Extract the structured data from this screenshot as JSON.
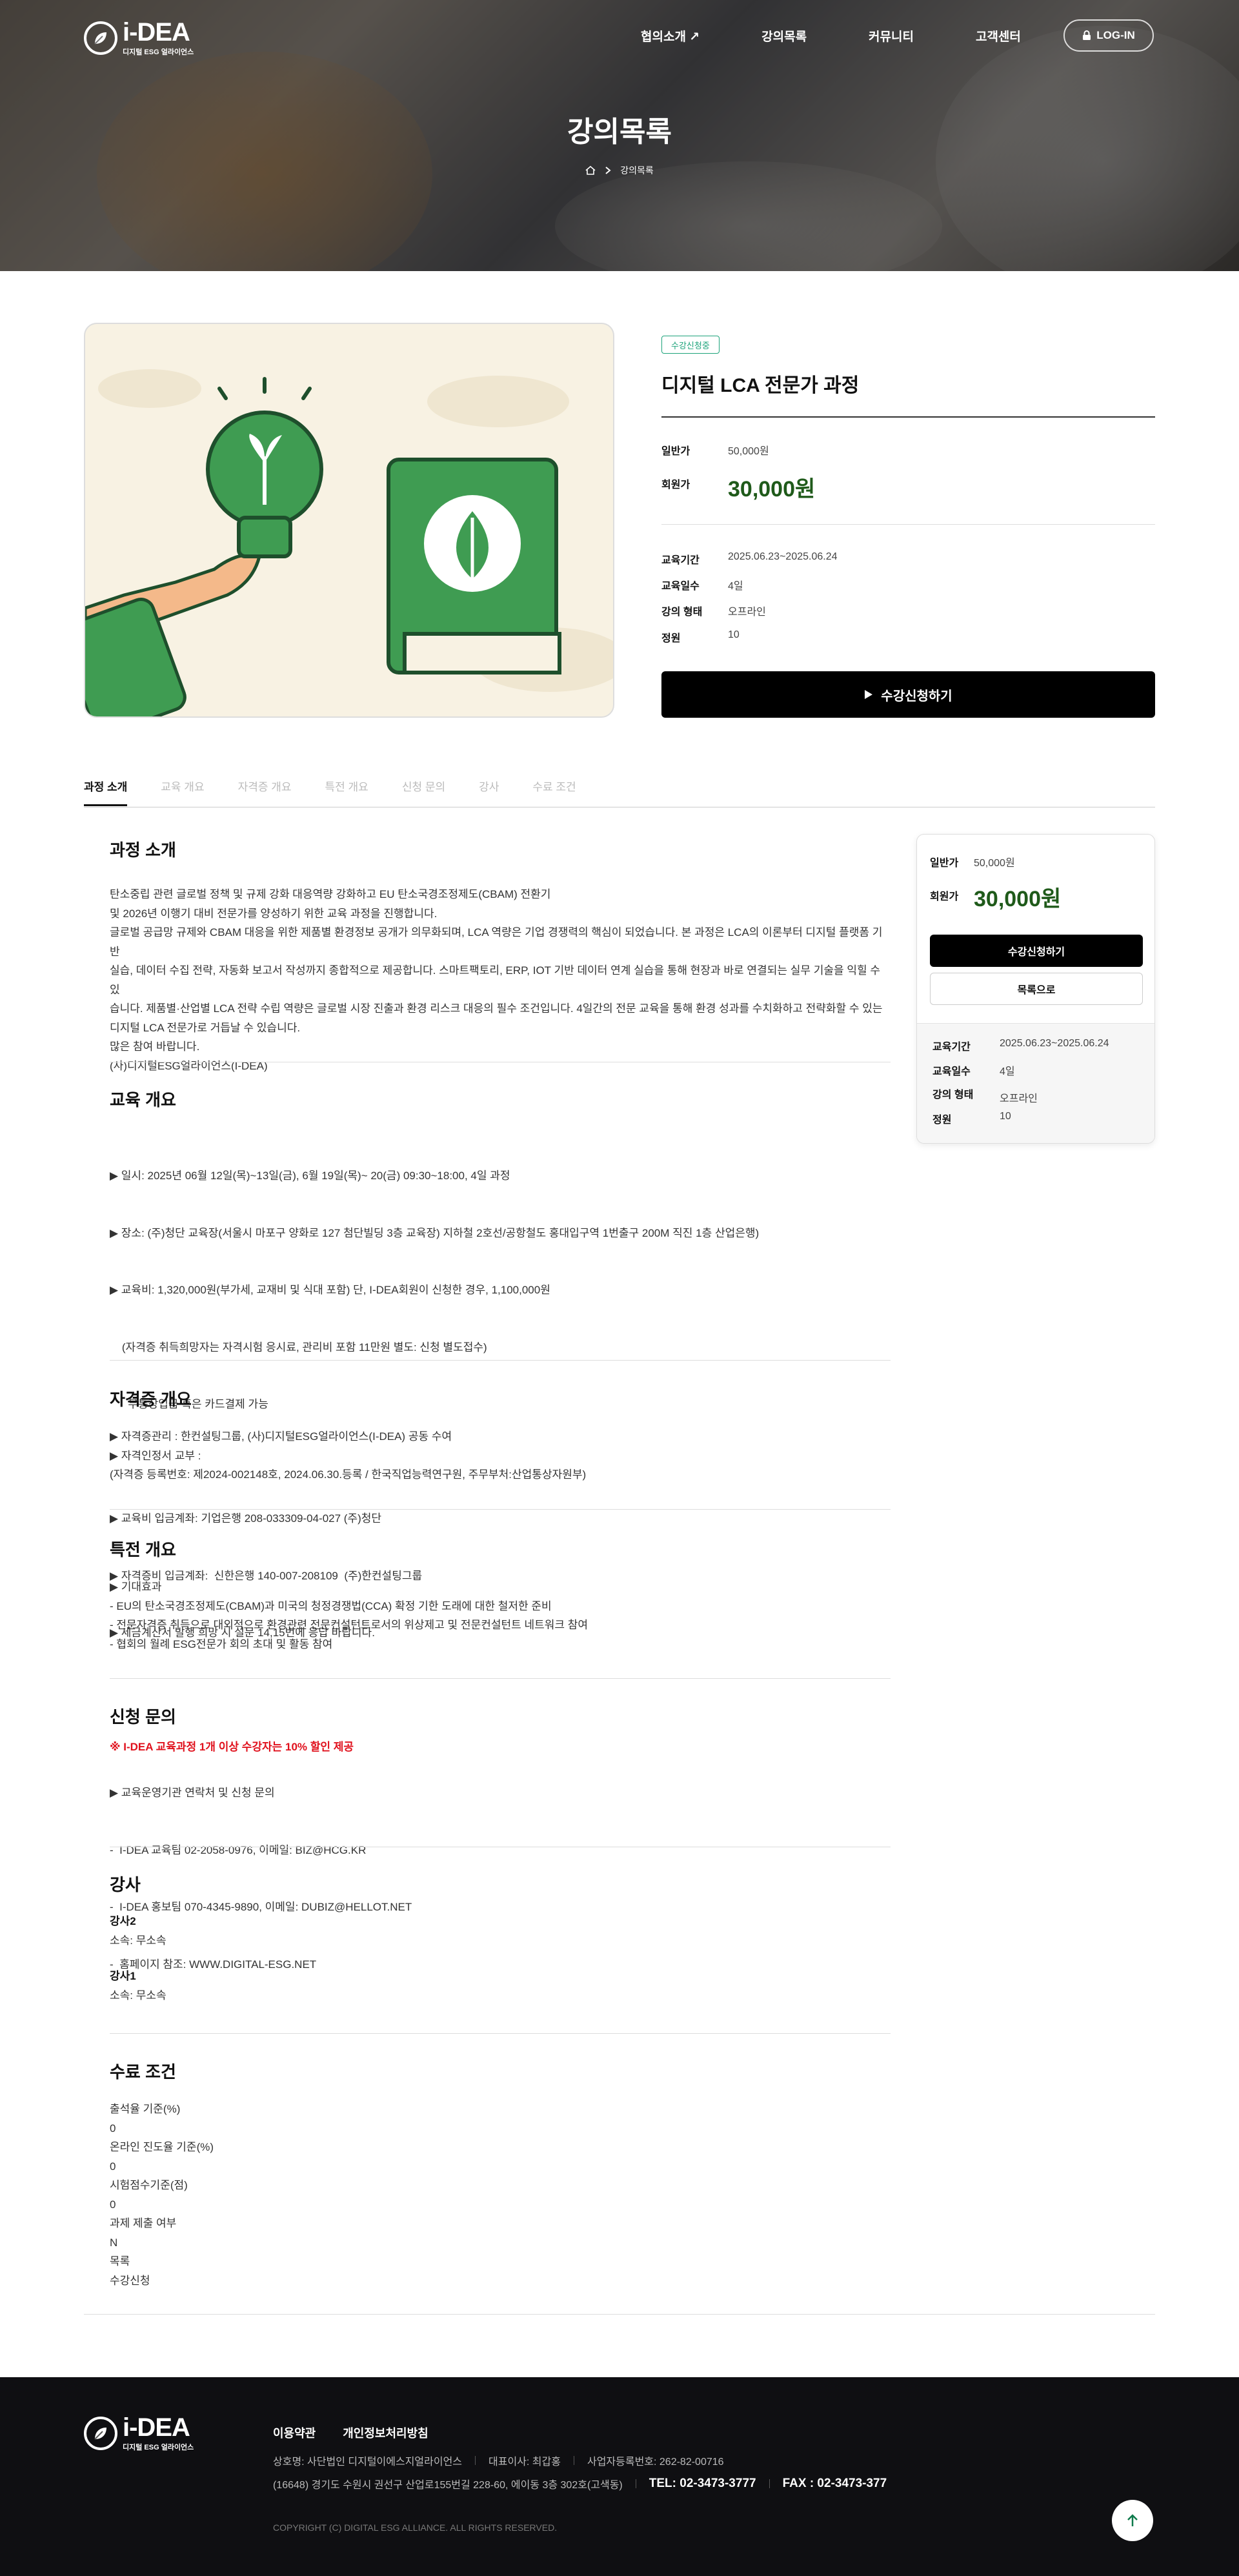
{
  "brand": {
    "logo_main": "i-DEA",
    "logo_sub": "디지털 ESG 얼라이언스"
  },
  "nav": [
    "협의소개 ↗",
    "강의목록",
    "커뮤니티",
    "고객센터"
  ],
  "login_label": "LOG-IN",
  "hero": {
    "title": "강의목록",
    "crumb": "강의목록"
  },
  "course": {
    "status": "수강신청중",
    "title": "디지털 LCA 전문가 과정",
    "general_label": "일반가",
    "general_price": "50,000원",
    "member_label": "회원가",
    "member_price": "30,000원",
    "period_label": "교육기간",
    "period": "2025.06.23~2025.06.24",
    "days_label": "교육일수",
    "days": "4일",
    "type_label": "강의 형태",
    "type": "오프라인",
    "capacity_label": "정원",
    "capacity": "10",
    "apply_label": "수강신청하기"
  },
  "tabs": [
    "과정 소개",
    "교육 개요",
    "자격증 개요",
    "특전 개요",
    "신청 문의",
    "강사",
    "수료 조건"
  ],
  "sections": {
    "intro": {
      "title": "과정 소개",
      "lines": [
        "탄소중립 관련 글로벌 정책 및 규제 강화 대응역량 강화하고 EU 탄소국경조정제도(CBAM) 전환기",
        "및 2026년 이행기 대비 전문가를 양성하기 위한 교육 과정을 진행합니다.",
        "글로벌 공급망 규제와 CBAM 대응을 위한 제품별 환경정보 공개가 의무화되며, LCA 역량은 기업 경쟁력의 핵심이 되었습니다. 본 과정은 LCA의 이론부터 디지털 플랫폼 기반",
        "실습, 데이터 수집 전략, 자동화 보고서 작성까지 종합적으로 제공합니다. 스마트팩토리, ERP, IOT 기반 데이터 연계 실습을 통해 현장과 바로 연결되는 실무 기술을 익힐 수 있",
        "습니다. 제품별·산업별 LCA 전략 수립 역량은 글로벌 시장 진출과 환경 리스크 대응의 필수 조건입니다. 4일간의 전문 교육을 통해 환경 성과를 수치화하고 전략화할 수 있는",
        "디지털 LCA 전문가로 거듭날 수 있습니다.",
        "많은 참여 바랍니다.",
        "(사)디지털ESG얼라이언스(I-DEA)"
      ]
    },
    "overview": {
      "title": "교육 개요",
      "lines": [
        "▶ 일시: 2025년 06월 12일(목)~13일(금), 6월 19일(목)~ 20(금) 09:30~18:00, 4일 과정",
        "▶ 장소: (주)청단 교육장(서울시 마포구 양화로 127 첨단빌딩 3층 교육장) 지하철 2호선/공항철도 홍대입구역 1번출구 200M 직진 1층 산업은행)",
        "▶ 교육비: 1,320,000원(부가세, 교재비 및 식대 포함) 단, I-DEA회원이 신청한 경우, 1,100,000원",
        "    (자격증 취득희망자는 자격시험 응시료, 관리비 포함 11만원 별도: 신청 별도접수)",
        "      무통장입금 혹은 카드결제 가능",
        "",
        "▶ 교육비 입금계좌: 기업은행 208-033309-04-027 (주)청단",
        "▶ 자격증비 입금계좌:  신한은행 140-007-208109  (주)한컨설팅그룹",
        "▶ 세금계산서 발행 희망 시 설문 14,15번에 응답 바랍니다.",
        ""
      ],
      "discount": "※ I-DEA 교육과정 1개 이상 수강자는 10% 할인 제공"
    },
    "cert": {
      "title": "자격증 개요",
      "lines": [
        "▶ 자격증관리 : 한컨설팅그룹, (사)디지털ESG얼라이언스(I-DEA) 공동 수여",
        "▶ 자격인정서 교부 :",
        "(자격증 등록번호: 제2024-002148호, 2024.06.30.등록 / 한국직업능력연구원, 주무부처:산업통상자원부)"
      ]
    },
    "benefit": {
      "title": "특전 개요",
      "lines": [
        "▶ 기대효과",
        "- EU의 탄소국경조정제도(CBAM)과 미국의 청정경쟁법(CCA) 확정 기한 도래에 대한 철저한 준비",
        "- 전문자격증 취득으로 대외적으로 환경관련 전문컨설턴트로서의 위상제고 및 전문컨설턴트 네트워크 참여",
        "- 협회의 월례 ESG전문가 회의 초대 및 활동 참여"
      ]
    },
    "inquiry": {
      "title": "신청 문의",
      "lines": [
        "▶ 교육운영기관 연락처 및 신청 문의",
        "-  I-DEA 교육팀 02-2058-0976, 이메일: BIZ@HCG.KR",
        "-  I-DEA 홍보팀 070-4345-9890, 이메일: DUBIZ@HELLOT.NET",
        "-  홈페이지 참조: WWW.DIGITAL-ESG.NET"
      ]
    },
    "instructor": {
      "title": "강사",
      "items": [
        {
          "name": "강사2",
          "affil": "소속: 무소속"
        },
        {
          "name": "강사1",
          "affil": "소속: 무소속"
        }
      ]
    },
    "completion": {
      "title": "수료 조건",
      "lines": [
        "출석율 기준(%)",
        "0",
        "온라인 진도율 기준(%)",
        "0",
        "시험점수기준(점)",
        "0",
        "과제 제출 여부",
        "N",
        "목록",
        "수강신청"
      ]
    }
  },
  "sidebar": {
    "general_label": "일반가",
    "general_price": "50,000원",
    "member_label": "회원가",
    "member_price": "30,000원",
    "apply_label": "수강신청하기",
    "list_label": "목록으로",
    "period_label": "교육기간",
    "period": "2025.06.23~2025.06.24",
    "days_label": "교육일수",
    "days": "4일",
    "type_label": "강의 형태",
    "type": "오프라인",
    "capacity_label": "정원",
    "capacity": "10"
  },
  "footer": {
    "links": [
      "이용약관",
      "개인정보처리방침"
    ],
    "company": "상호명: 사단법인 디지털이에스지얼라이언스",
    "ceo": "대표이사: 최갑홍",
    "bizno": "사업자등록번호: 262-82-00716",
    "address": "(16648) 경기도 수원시 권선구 산업로155번길 228-60, 에이동 3층 302호(고색동)",
    "tel": "TEL: 02-3473-3777",
    "fax": "FAX : 02-3473-377",
    "copyright": "COPYRIGHT (C) DIGITAL ESG ALLIANCE. ALL RIGHTS RESERVED."
  },
  "colors": {
    "accent_green": "#1ca37a",
    "price_green": "#1f5a1a",
    "discount_red": "#e0101c",
    "footer_bg": "#0f0f12"
  },
  "icons": [
    "leaf-logo-icon",
    "lock-icon",
    "home-icon",
    "chevron-right-icon",
    "play-icon",
    "arrow-up-icon"
  ]
}
